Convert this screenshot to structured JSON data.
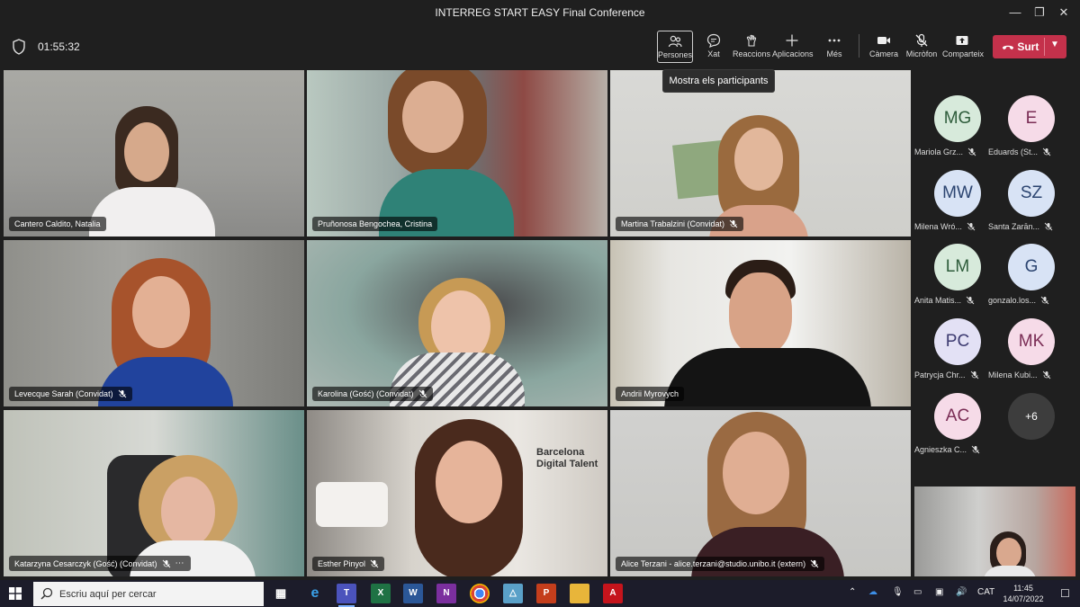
{
  "window": {
    "title": "INTERREG START EASY Final Conference",
    "controls": [
      "minimize-icon",
      "restore-icon",
      "close-icon"
    ]
  },
  "toolbar": {
    "timer": "01:55:32",
    "buttons": {
      "people": "Persones",
      "chat": "Xat",
      "reactions": "Reaccions",
      "apps": "Aplicacions",
      "more": "Més",
      "camera": "Càmera",
      "mic": "Micròfon",
      "share": "Comparteix"
    },
    "leave": "Surt",
    "tooltip": "Mostra els participants"
  },
  "participants": [
    {
      "name": "Cantero Caldito, Natalia",
      "muted": false
    },
    {
      "name": "Pruñonosa Bengochea, Cristina",
      "muted": false
    },
    {
      "name": "Martina Trabalzini (Convidat)",
      "muted": true
    },
    {
      "name": "Levecque Sarah (Convidat)",
      "muted": true
    },
    {
      "name": "Karolina (Gość) (Convidat)",
      "muted": true
    },
    {
      "name": "Andrii Myrovych",
      "muted": false
    },
    {
      "name": "Katarzyna Cesarczyk (Gość) (Convidat)",
      "muted": true
    },
    {
      "name": "Esther Pinyol",
      "muted": true
    },
    {
      "name": "Alice Terzani - alice.terzani@studio.unibo.it (extern)",
      "muted": true
    }
  ],
  "background_text": {
    "line1": "Barcelona",
    "line2": "Digital Talent"
  },
  "avatars": [
    {
      "initials": "MG",
      "name": "Mariola Grz...",
      "bg": "#d7eadb",
      "fg": "#2e5c3b"
    },
    {
      "initials": "E",
      "name": "Eduards (St...",
      "bg": "#f6dbe8",
      "fg": "#7a2d55"
    },
    {
      "initials": "MW",
      "name": "Milena Wró...",
      "bg": "#d8e3f5",
      "fg": "#2b4470"
    },
    {
      "initials": "SZ",
      "name": "Santa Zarān...",
      "bg": "#d8e3f5",
      "fg": "#2b4470"
    },
    {
      "initials": "LM",
      "name": "Anita Matis...",
      "bg": "#d7eadb",
      "fg": "#2e5c3b"
    },
    {
      "initials": "G",
      "name": "gonzalo.los...",
      "bg": "#d8e3f5",
      "fg": "#2b4470"
    },
    {
      "initials": "PC",
      "name": "Patrycja Chr...",
      "bg": "#e3e1f5",
      "fg": "#3c3a70"
    },
    {
      "initials": "MK",
      "name": "Milena Kubi...",
      "bg": "#f6dbe8",
      "fg": "#7a2d55"
    },
    {
      "initials": "AC",
      "name": "Agnieszka C...",
      "bg": "#f6dbe8",
      "fg": "#7a2d55"
    }
  ],
  "overflow_count": "+6",
  "taskbar": {
    "search_placeholder": "Escriu aquí per cercar",
    "apps": [
      "task-view",
      "edge",
      "teams",
      "excel",
      "word",
      "onenote",
      "chrome",
      "photos",
      "powerpoint",
      "file-explorer",
      "acrobat"
    ],
    "language": "CAT",
    "time": "11:45",
    "date": "14/07/2022"
  },
  "colors": {
    "accent": "#8b8cc7",
    "leave": "#c4314b",
    "taskbar": "#1c1c2a"
  }
}
